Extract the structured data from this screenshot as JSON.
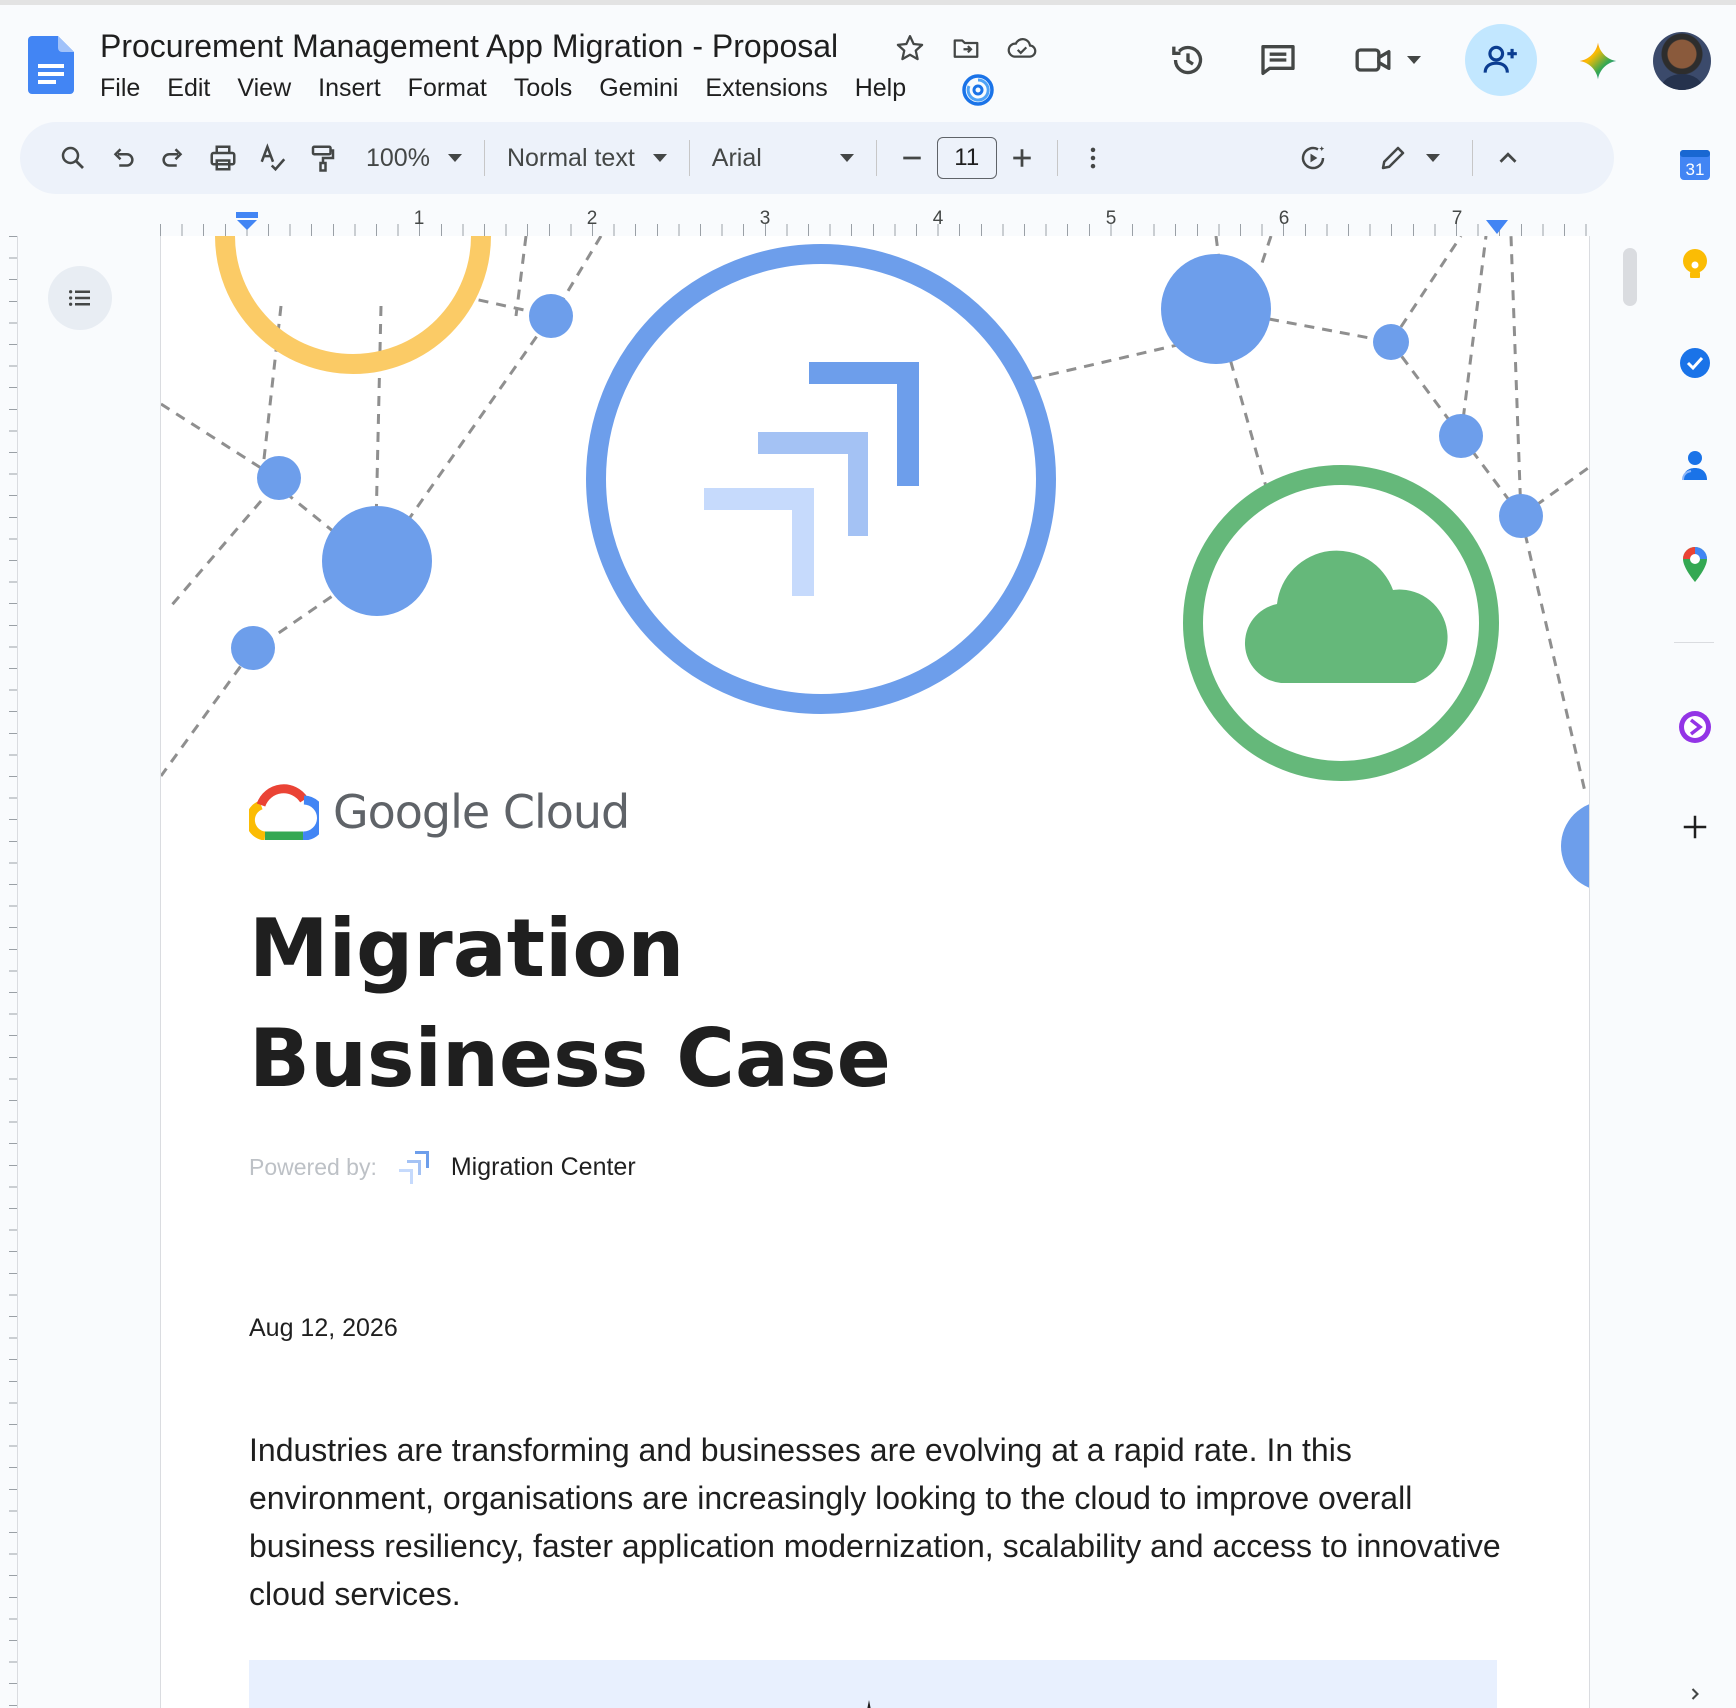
{
  "app": {
    "doc_title": "Procurement Management App Migration - Proposal",
    "menu": [
      "File",
      "Edit",
      "View",
      "Insert",
      "Format",
      "Tools",
      "Gemini",
      "Extensions",
      "Help"
    ]
  },
  "toolbar": {
    "zoom": "100%",
    "style": "Normal text",
    "font": "Arial",
    "font_size": "11"
  },
  "ruler": {
    "numbers": [
      "1",
      "2",
      "3",
      "4",
      "5",
      "6",
      "7"
    ]
  },
  "document": {
    "brand": "Google Cloud",
    "heading_line1": "Migration",
    "heading_line2": "Business Case",
    "powered_label": "Powered by:",
    "powered_name": "Migration Center",
    "date": "Aug 12, 2026",
    "paragraph": "Industries are transforming and businesses are evolving at a rapid rate. In this environment, organisations are increasingly looking to the cloud to improve overall business resiliency, faster application modernization, scalability and access to innovative cloud services."
  },
  "side_panel": {
    "calendar_day": "31",
    "icons": [
      "calendar-icon",
      "keep-icon",
      "tasks-icon",
      "contacts-icon",
      "maps-icon",
      "addon-icon",
      "add-icon"
    ]
  },
  "colors": {
    "accent_blue": "#6d9eeb",
    "light_blue": "#a4c2f4",
    "green": "#65b87a",
    "yellow": "#fbcb66",
    "share_bg": "#c2e7ff"
  }
}
